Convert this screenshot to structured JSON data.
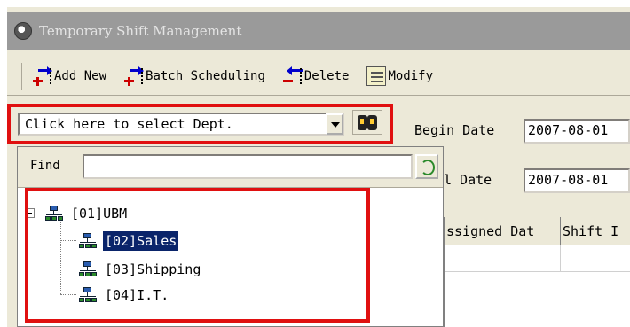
{
  "window": {
    "title": "Temporary Shift Management"
  },
  "toolbar": {
    "add_new": "Add New",
    "batch_scheduling": "Batch Scheduling",
    "delete": "Delete",
    "modify": "Modify"
  },
  "dept_selector": {
    "value": "Click here to select Dept."
  },
  "find": {
    "label": "Find",
    "value": ""
  },
  "tree": {
    "nodes": [
      {
        "label": "[01]UBM",
        "selected": false
      },
      {
        "label": "[02]Sales",
        "selected": true
      },
      {
        "label": "[03]Shipping",
        "selected": false
      },
      {
        "label": "[04]I.T.",
        "selected": false
      }
    ]
  },
  "filters": {
    "begin_date_label": "Begin Date",
    "begin_date_value": "2007-08-01",
    "end_date_label": "l Date",
    "end_date_value": "2007-08-01"
  },
  "grid": {
    "columns": [
      "ssigned Dat",
      "Shift I"
    ]
  },
  "colors": {
    "highlight_box": "#e01010",
    "selection": "#0a246a",
    "titlebar": "#9a9a9a"
  }
}
